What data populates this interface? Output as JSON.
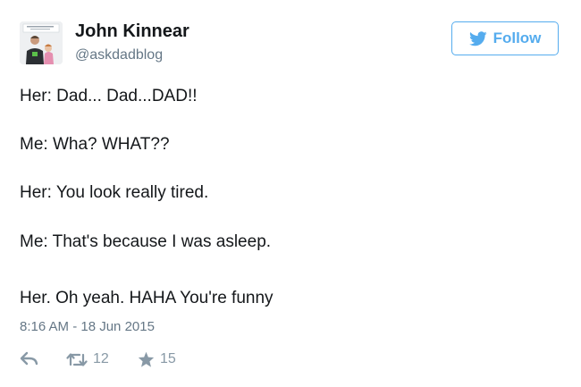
{
  "user": {
    "name": "John Kinnear",
    "handle": "@askdadblog"
  },
  "follow_button": {
    "label": "Follow",
    "icon": "twitter-bird-icon",
    "color": "#55acee"
  },
  "tweet": {
    "lines": [
      "Her: Dad... Dad...DAD!!",
      "Me: Wha? WHAT??",
      "Her: You look really tired.",
      "Me: That's because I was asleep.",
      "Her. Oh yeah. HAHA You're funny"
    ],
    "timestamp": "8:16 AM - 18 Jun 2015"
  },
  "actions": {
    "reply_icon": "reply-icon",
    "retweet_icon": "retweet-icon",
    "retweet_count": "12",
    "favorite_icon": "star-icon",
    "favorite_count": "15"
  }
}
